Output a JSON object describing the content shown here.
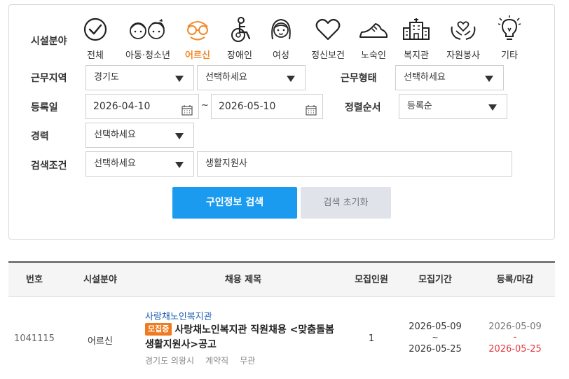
{
  "search": {
    "labels": {
      "category": "시설분야",
      "region": "근무지역",
      "work_type": "근무형태",
      "reg_date": "등록일",
      "sort": "정렬순서",
      "career": "경력",
      "condition": "검색조건"
    },
    "categories": [
      {
        "label": "전체",
        "icon": "check-circle-icon",
        "active": false
      },
      {
        "label": "아동·청소년",
        "icon": "children-icon",
        "active": false
      },
      {
        "label": "어르신",
        "icon": "elderly-icon",
        "active": true
      },
      {
        "label": "장애인",
        "icon": "wheelchair-icon",
        "active": false
      },
      {
        "label": "여성",
        "icon": "woman-icon",
        "active": false
      },
      {
        "label": "정신보건",
        "icon": "heart-icon",
        "active": false
      },
      {
        "label": "노숙인",
        "icon": "shoe-icon",
        "active": false
      },
      {
        "label": "복지관",
        "icon": "building-icon",
        "active": false
      },
      {
        "label": "자원봉사",
        "icon": "heart-hands-icon",
        "active": false
      },
      {
        "label": "기타",
        "icon": "lightbulb-icon",
        "active": false
      }
    ],
    "region_province": "경기도",
    "region_city": "선택하세요",
    "work_type": "선택하세요",
    "date_from": "2026-04-10",
    "date_sep": "~",
    "date_to": "2026-05-10",
    "sort": "등록순",
    "career": "선택하세요",
    "condition": "선택하세요",
    "keyword": "생활지원사",
    "search_button": "구인정보 검색",
    "reset_button": "검색 초기화"
  },
  "table": {
    "headers": [
      "번호",
      "시설분야",
      "채용 제목",
      "모집인원",
      "모집기간",
      "등록/마감"
    ],
    "rows": [
      {
        "no": "1041115",
        "category": "어르신",
        "org": "사랑채노인복지관",
        "status": "모집중",
        "title": "사랑채노인복지관 직원채용 <맞춤돌봄 생활지원사>공고",
        "location": "경기도 의왕시",
        "employment": "계약직",
        "salary": "무관",
        "count": "1",
        "period_start": "2026-05-09",
        "period_sep": "~",
        "period_end": "2026-05-25",
        "registered": "2026-05-09",
        "deadline_sep": "-",
        "deadline": "2026-05-25"
      }
    ]
  },
  "colors": {
    "accent": "#1a9bf0",
    "active_category": "#f08a2c",
    "badge": "#f07a1f",
    "org_link": "#1d5fb3",
    "deadline": "#e2383f"
  }
}
